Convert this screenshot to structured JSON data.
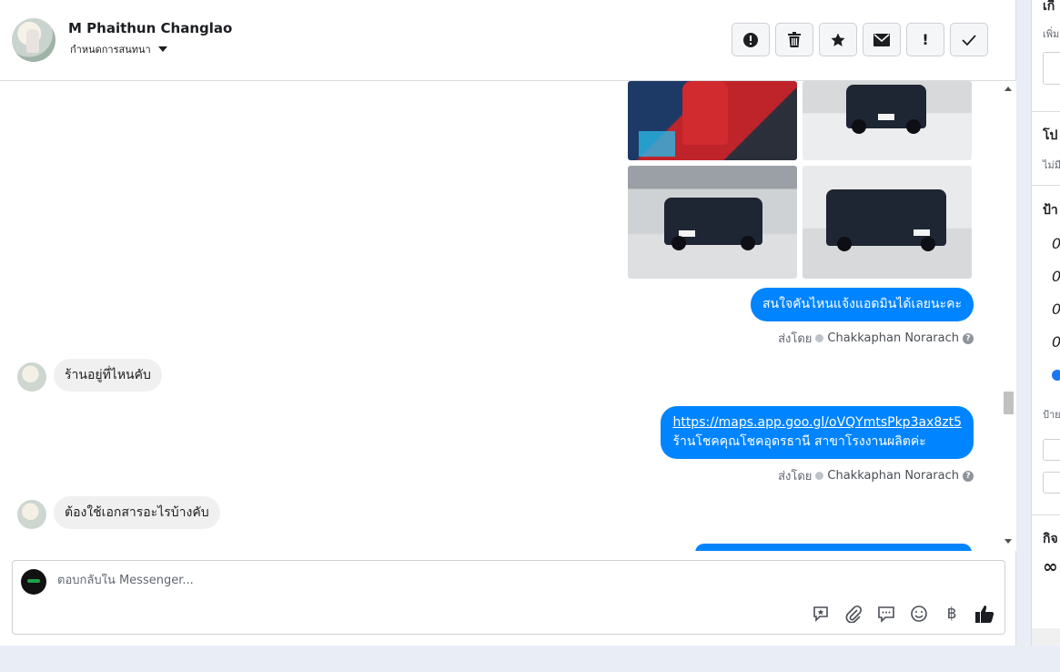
{
  "header": {
    "contact_name": "M Phaithun Changlao",
    "assign_label": "กำหนดการสนทนา",
    "toolbar": [
      {
        "name": "mark-spam-button",
        "icon": "alert-circle-icon",
        "glyph": "!"
      },
      {
        "name": "delete-button",
        "icon": "trash-icon",
        "glyph": ""
      },
      {
        "name": "star-button",
        "icon": "star-icon",
        "glyph": "★"
      },
      {
        "name": "mark-unread-button",
        "icon": "envelope-icon",
        "glyph": "✉"
      },
      {
        "name": "follow-up-button",
        "icon": "exclamation-icon",
        "glyph": "!"
      },
      {
        "name": "mark-done-button",
        "icon": "check-icon",
        "glyph": "✓"
      }
    ]
  },
  "messages": [
    {
      "type": "outgoing",
      "text": "สนใจคันไหนแจ้งแอดมินได้เลยนะคะ"
    },
    {
      "type": "meta",
      "prefix": "ส่งโดย",
      "sender": "Chakkaphan Norarach"
    },
    {
      "type": "incoming",
      "text": "ร้านอยู่ที่ไหนคับ"
    },
    {
      "type": "outgoing_link",
      "link": "https://maps.app.goo.gl/oVQYmtsPkp3ax8zt5",
      "text": "ร้านโชคคุณโชคอุดรธานี สาขาโรงงานผลิตค่ะ"
    },
    {
      "type": "meta",
      "prefix": "ส่งโดย",
      "sender": "Chakkaphan Norarach"
    },
    {
      "type": "incoming",
      "text": "ต้องใช้เอกสารอะไรบ้างคับ"
    }
  ],
  "composer": {
    "placeholder": "ตอบกลับใน Messenger...",
    "icons": [
      "saved-reply-icon",
      "attachment-icon",
      "chat-bubble-icon",
      "emoji-icon",
      "baht-icon",
      "like-icon"
    ]
  },
  "right_panel": {
    "title_1": "เกี่",
    "small_1": "เพิ่ม",
    "title_2": "โป",
    "small_2": "ไม่มี",
    "title_3": "ป้า",
    "digits": [
      "0",
      "0",
      "0",
      "0"
    ],
    "small_3": "ป้าย",
    "title_4": "กิจ",
    "infinity": "∞"
  },
  "colors": {
    "accent": "#0084ff",
    "incoming_bubble": "#f1f0f0",
    "page_bg": "#e9edf6"
  }
}
